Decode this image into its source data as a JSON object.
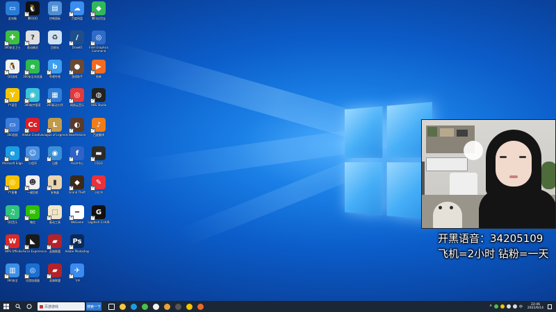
{
  "desktop": {
    "icons": [
      {
        "label": "此电脑",
        "color": "#2a7bd6",
        "glyph": "▭",
        "arrow": false
      },
      {
        "label": "腾讯QQ",
        "color": "#111111",
        "glyph": "🐧",
        "arrow": true
      },
      {
        "label": "控制面板",
        "color": "#4d8fd6",
        "glyph": "▤",
        "arrow": false
      },
      {
        "label": "百度网盘",
        "color": "#3a8ef0",
        "glyph": "☁",
        "arrow": true
      },
      {
        "label": "腾讯应用宝",
        "color": "#30b85c",
        "glyph": "◆",
        "arrow": true
      },
      {
        "label": "360安全卫士",
        "color": "#3fbf3f",
        "glyph": "✚",
        "arrow": true
      },
      {
        "label": "驱动精灵",
        "color": "#e0e0e0",
        "glyph": "?",
        "arrow": true
      },
      {
        "label": "回收站",
        "color": "#cfe3f5",
        "glyph": "♻",
        "arrow": false
      },
      {
        "label": "DrawIO",
        "color": "#1f4f8a",
        "glyph": "/",
        "arrow": true
      },
      {
        "label": "Intel Graphics Command",
        "color": "#2f6bc8",
        "glyph": "◎",
        "arrow": true
      },
      {
        "label": "QQ游戏",
        "color": "#f2f2f2",
        "glyph": "🐧",
        "arrow": true
      },
      {
        "label": "360安全浏览器",
        "color": "#2dbb4f",
        "glyph": "e",
        "arrow": true
      },
      {
        "label": "哔哩哔哩",
        "color": "#3d9ef0",
        "glyph": "b",
        "arrow": true
      },
      {
        "label": "游戏助手",
        "color": "#6b4a32",
        "glyph": "●",
        "arrow": true
      },
      {
        "label": "剪映",
        "color": "#f26b21",
        "glyph": "▶",
        "arrow": true
      },
      {
        "label": "YY语音",
        "color": "#f5c400",
        "glyph": "Y",
        "arrow": true
      },
      {
        "label": "360软件管家",
        "color": "#3dc2d6",
        "glyph": "◉",
        "arrow": true
      },
      {
        "label": "360驱动大师",
        "color": "#2f7fd6",
        "glyph": "▦",
        "arrow": true
      },
      {
        "label": "网易云音乐",
        "color": "#e23a3a",
        "glyph": "◎",
        "arrow": true
      },
      {
        "label": "OBS Studio",
        "color": "#222222",
        "glyph": "◍",
        "arrow": true
      },
      {
        "label": "360画报",
        "color": "#3c7bd8",
        "glyph": "▭",
        "arrow": true
      },
      {
        "label": "Adobe Creative",
        "color": "#da1f26",
        "glyph": "Cc",
        "arrow": true
      },
      {
        "label": "League of Legends",
        "color": "#c29b4a",
        "glyph": "L",
        "arrow": true
      },
      {
        "label": "Hearthstone",
        "color": "#5b3a2a",
        "glyph": "◐",
        "arrow": true
      },
      {
        "label": "百度翻译",
        "color": "#f07d1a",
        "glyph": "♪",
        "arrow": true
      },
      {
        "label": "Microsoft Edge",
        "color": "#1b9de2",
        "glyph": "e",
        "arrow": true
      },
      {
        "label": "小程序",
        "color": "#4a8fe0",
        "glyph": "☺",
        "arrow": true
      },
      {
        "label": "迅雷",
        "color": "#3b8fd6",
        "glyph": "◉",
        "arrow": true
      },
      {
        "label": "Flash中心",
        "color": "#2e63c8",
        "glyph": "f",
        "arrow": true
      },
      {
        "label": "CSGO",
        "color": "#2b2b2b",
        "glyph": "▬",
        "arrow": true
      },
      {
        "label": "YY直播",
        "color": "#f5c400",
        "glyph": "◎",
        "arrow": true
      },
      {
        "label": "一键回收",
        "color": "#f0f0f0",
        "glyph": "☻",
        "arrow": true
      },
      {
        "label": "安装器",
        "color": "#e8d5b0",
        "glyph": "▮",
        "arrow": true
      },
      {
        "label": "Grand Theft",
        "color": "#3a2a1a",
        "glyph": "◆",
        "arrow": true
      },
      {
        "label": "小红书",
        "color": "#e8323c",
        "glyph": "✎",
        "arrow": true
      },
      {
        "label": "QQ音乐",
        "color": "#31c27c",
        "glyph": "♫",
        "arrow": true
      },
      {
        "label": "微信",
        "color": "#2dc100",
        "glyph": "✉",
        "arrow": true
      },
      {
        "label": "驱动工具",
        "color": "#f1e6c8",
        "glyph": "⬚",
        "arrow": true
      },
      {
        "label": "WeGame",
        "color": "#ffffff",
        "glyph": "━",
        "arrow": true
      },
      {
        "label": "Logitech G HUB",
        "color": "#111111",
        "glyph": "G",
        "arrow": true
      },
      {
        "label": "WPS Office",
        "color": "#d82a2a",
        "glyph": "W",
        "arrow": true
      },
      {
        "label": "GeForce Experience",
        "color": "#1a1a1a",
        "glyph": "◣",
        "arrow": true
      },
      {
        "label": "英雄联盟",
        "color": "#b3222a",
        "glyph": "▰",
        "arrow": true
      },
      {
        "label": "Adobe Photoshop",
        "color": "#0b2a5a",
        "glyph": "Ps",
        "arrow": true
      },
      {
        "label": "360安全",
        "color": "#3d8fe6",
        "glyph": "▥",
        "arrow": true
      },
      {
        "label": "迅游加速器",
        "color": "#1a6fd1",
        "glyph": "◎",
        "arrow": true
      },
      {
        "label": "英雄联盟",
        "color": "#b3222a",
        "glyph": "▰",
        "arrow": true
      },
      {
        "label": "飞书",
        "color": "#3b8bf0",
        "glyph": "✈",
        "arrow": true
      }
    ]
  },
  "overlay": {
    "line1": "开黑语音：34205109",
    "line2": "飞机=2小时 钻粉=一天"
  },
  "taskbar": {
    "search_placeholder": "页游游戏",
    "search_button": "搜索一下",
    "apps": [
      {
        "name": "task-view-icon",
        "color": "#ffffff"
      },
      {
        "name": "file-explorer-icon",
        "color": "#f5c842"
      },
      {
        "name": "edge-icon",
        "color": "#1b9de2"
      },
      {
        "name": "360-browser-icon",
        "color": "#4cc04c"
      },
      {
        "name": "chrome-icon",
        "color": "#f2f2f2"
      },
      {
        "name": "photos-icon",
        "color": "#e8a33c"
      },
      {
        "name": "obs-icon",
        "color": "#555555"
      },
      {
        "name": "yy-icon",
        "color": "#f5c400"
      },
      {
        "name": "game-icon",
        "color": "#e86a2a"
      }
    ],
    "clock_time": "22:46",
    "clock_date": "2022/6/14"
  }
}
